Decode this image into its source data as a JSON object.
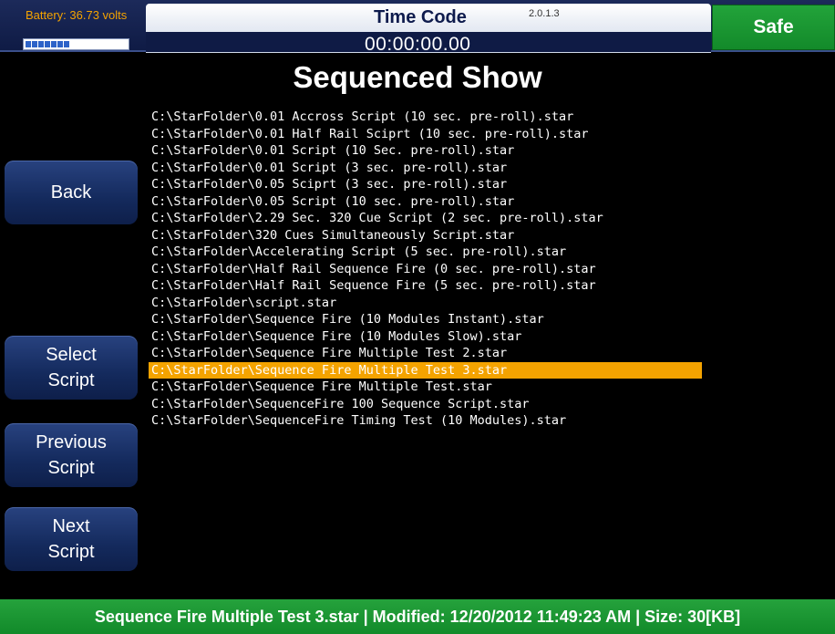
{
  "header": {
    "battery_text": "Battery: 36.73 volts",
    "battery_level": 0.45,
    "timecode_label": "Time Code",
    "version": "2.0.1.3",
    "timecode_value": "00:00:00.00",
    "safe_label": "Safe"
  },
  "page_title": "Sequenced Show",
  "sidebar": {
    "back": "Back",
    "select_script": "Select\nScript",
    "previous_script": "Previous\nScript",
    "next_script": "Next\nScript"
  },
  "files": [
    "C:\\StarFolder\\0.01 Accross Script (10 sec. pre-roll).star",
    "C:\\StarFolder\\0.01 Half Rail Sciprt (10 sec. pre-roll).star",
    "C:\\StarFolder\\0.01 Script (10 Sec. pre-roll).star",
    "C:\\StarFolder\\0.01 Script (3 sec. pre-roll).star",
    "C:\\StarFolder\\0.05 Sciprt (3 sec. pre-roll).star",
    "C:\\StarFolder\\0.05 Script (10 sec. pre-roll).star",
    "C:\\StarFolder\\2.29 Sec. 320 Cue Script (2 sec. pre-roll).star",
    "C:\\StarFolder\\320 Cues Simultaneously Script.star",
    "C:\\StarFolder\\Accelerating Script (5 sec. pre-roll).star",
    "C:\\StarFolder\\Half Rail Sequence Fire (0 sec. pre-roll).star",
    "C:\\StarFolder\\Half Rail Sequence Fire (5 sec. pre-roll).star",
    "C:\\StarFolder\\script.star",
    "C:\\StarFolder\\Sequence Fire (10 Modules Instant).star",
    "C:\\StarFolder\\Sequence Fire (10 Modules Slow).star",
    "C:\\StarFolder\\Sequence Fire Multiple Test 2.star",
    "C:\\StarFolder\\Sequence Fire Multiple Test 3.star",
    "C:\\StarFolder\\Sequence Fire Multiple Test.star",
    "C:\\StarFolder\\SequenceFire 100 Sequence Script.star",
    "C:\\StarFolder\\SequenceFire Timing Test (10 Modules).star"
  ],
  "selected_index": 15,
  "status_bar": "Sequence Fire Multiple Test 3.star | Modified: 12/20/2012 11:49:23 AM | Size: 30[KB]",
  "colors": {
    "selection": "#f4a300",
    "safe": "#1e9a35",
    "header_navy": "#0f1b45"
  }
}
